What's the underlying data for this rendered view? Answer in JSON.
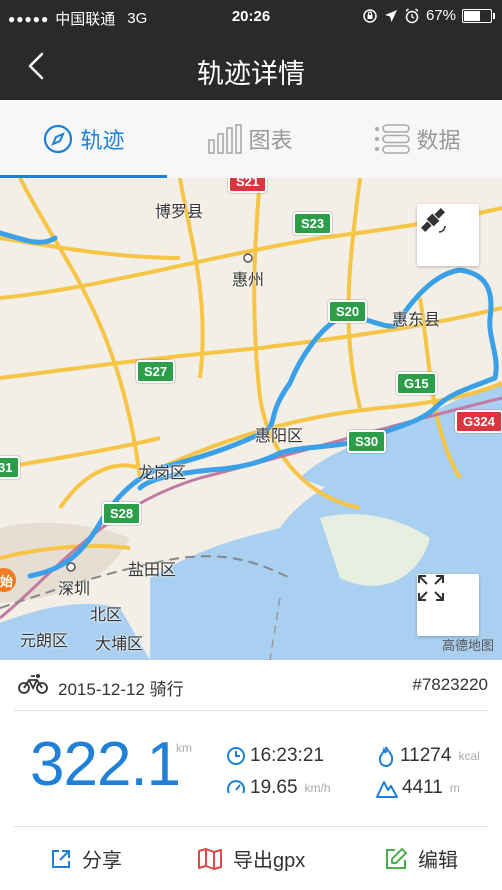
{
  "status": {
    "signal": "●●●●●",
    "carrier": "中国联通",
    "network": "3G",
    "time": "20:26",
    "battery": "67%",
    "battery_level": 0.67
  },
  "nav": {
    "title": "轨迹详情"
  },
  "tabs": [
    {
      "label": "轨迹",
      "icon": "compass-icon",
      "active": true
    },
    {
      "label": "图表",
      "icon": "bar-chart-icon",
      "active": false
    },
    {
      "label": "数据",
      "icon": "list-icon",
      "active": false
    }
  ],
  "map": {
    "places": [
      "博罗县",
      "惠州",
      "惠东县",
      "惠阳区",
      "龙岗区",
      "盐田区",
      "深圳",
      "北区",
      "元朗区",
      "大埔区"
    ],
    "roads": [
      "S23",
      "S20",
      "S27",
      "G15",
      "G324",
      "S30",
      "S28",
      "S21",
      "31"
    ],
    "start_marker": "始",
    "brand": "高德地图"
  },
  "ride": {
    "date": "2015-12-12 骑行",
    "id": "#7823220",
    "distance": "322.1",
    "distance_unit": "km",
    "duration": "16:23:21",
    "speed": "19.65",
    "speed_unit": "km/h",
    "calories": "11274",
    "calories_unit": "kcal",
    "elevation": "4411",
    "elevation_unit": "m"
  },
  "actions": {
    "share": "分享",
    "export": "导出gpx",
    "edit": "编辑"
  },
  "colors": {
    "accent": "#1f80d6",
    "bar": "#2a2a2a",
    "route": "#3aa0e8"
  }
}
